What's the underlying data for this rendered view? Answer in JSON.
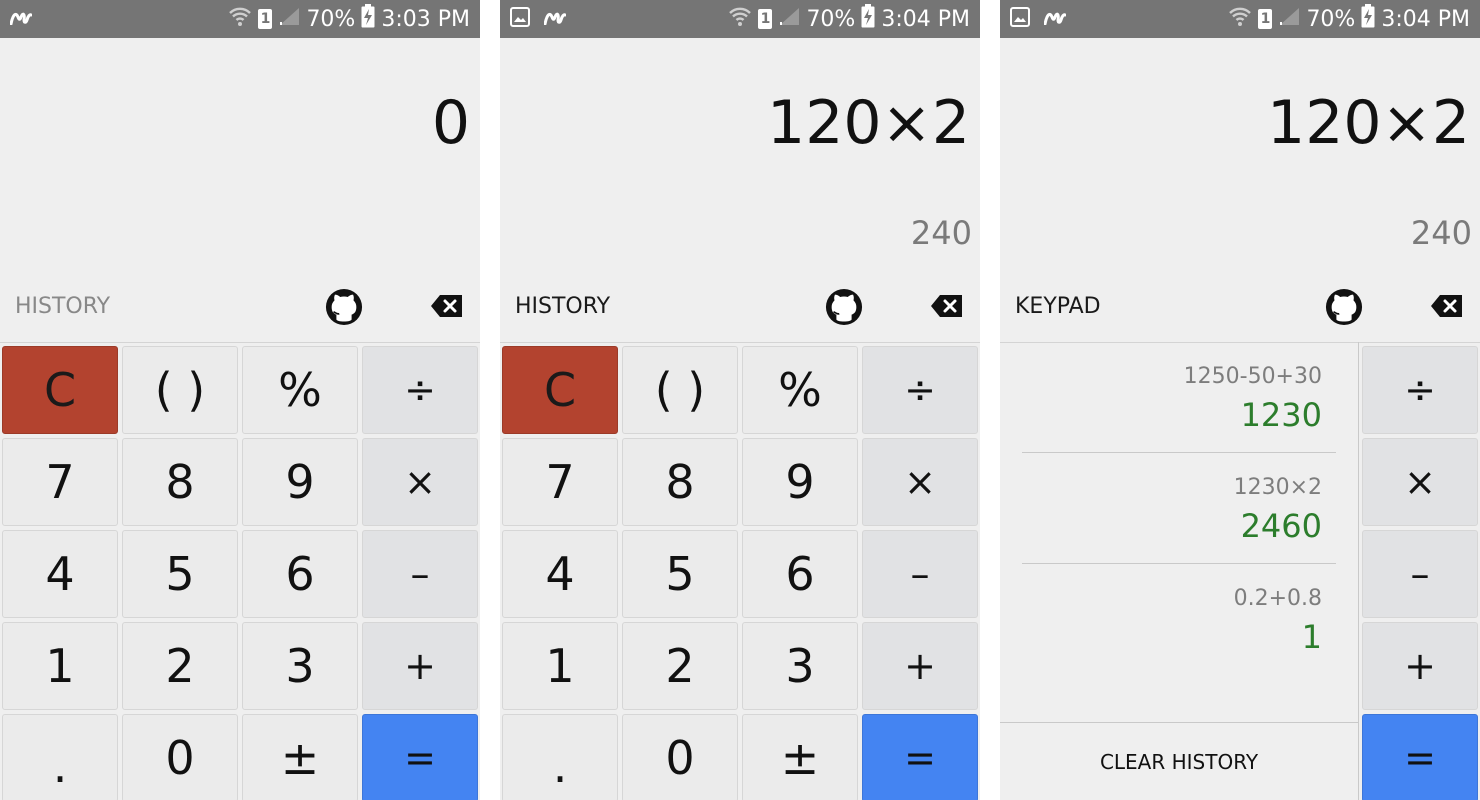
{
  "screens": [
    {
      "status": {
        "battery": "70%",
        "time": "3:03 PM",
        "sim": "1"
      },
      "display": {
        "expression": "0",
        "result": ""
      },
      "toolbar": {
        "label": "HISTORY"
      },
      "keypad": [
        "C",
        "( )",
        "%",
        "÷",
        "7",
        "8",
        "9",
        "×",
        "4",
        "5",
        "6",
        "–",
        "1",
        "2",
        "3",
        "+",
        ".",
        "0",
        "±",
        "="
      ]
    },
    {
      "status": {
        "battery": "70%",
        "time": "3:04 PM",
        "sim": "1"
      },
      "display": {
        "expression": "120×2",
        "result": "240"
      },
      "toolbar": {
        "label": "HISTORY"
      },
      "keypad": [
        "C",
        "( )",
        "%",
        "÷",
        "7",
        "8",
        "9",
        "×",
        "4",
        "5",
        "6",
        "–",
        "1",
        "2",
        "3",
        "+",
        ".",
        "0",
        "±",
        "="
      ]
    },
    {
      "status": {
        "battery": "70%",
        "time": "3:04 PM",
        "sim": "1"
      },
      "display": {
        "expression": "120×2",
        "result": "240"
      },
      "toolbar": {
        "label": "KEYPAD"
      },
      "history": [
        {
          "expression": "1250-50+30",
          "result": "1230"
        },
        {
          "expression": "1230×2",
          "result": "2460"
        },
        {
          "expression": "0.2+0.8",
          "result": "1"
        }
      ],
      "clear_history_label": "CLEAR HISTORY",
      "operators": [
        "÷",
        "×",
        "–",
        "+",
        "="
      ]
    }
  ],
  "colors": {
    "status_bar": "#757575",
    "background": "#efefef",
    "clear_key": "#b3432f",
    "equals_key": "#4484f2",
    "history_result": "#2c7d2c"
  },
  "icons": [
    "movistar-icon",
    "gallery-icon",
    "wifi-icon",
    "sim-icon",
    "signal-icon",
    "battery-charging-icon",
    "github-icon",
    "backspace-icon"
  ]
}
